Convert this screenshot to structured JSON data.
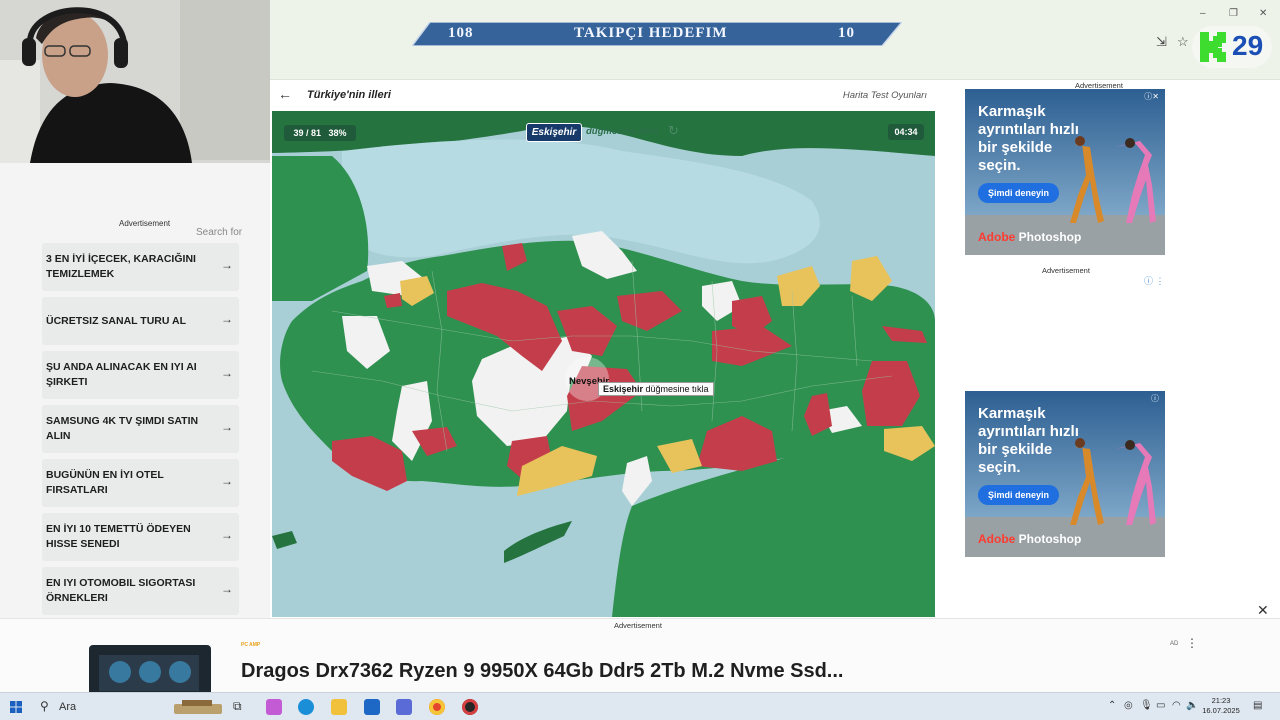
{
  "banner": {
    "left_number": "108",
    "title": "TAKIPÇI HEDEFIM",
    "right_number": "10"
  },
  "window_controls": {
    "minimize": "–",
    "maximize": "❐",
    "close": "✕"
  },
  "badge": {
    "letter": "K",
    "count": "29"
  },
  "left_sidebar": {
    "ad_label": "Advertisement",
    "search_for": "Search for",
    "links": [
      {
        "label": "3 EN İYİ İÇECEK, KARACIĞINI TEMIZLEMEK"
      },
      {
        "label": "ÜCRETSIZ SANAL TURU AL"
      },
      {
        "label": "ŞU ANDA ALINACAK EN IYI AI ŞIRKETI"
      },
      {
        "label": "SAMSUNG 4K TV ŞIMDI SATIN ALIN"
      },
      {
        "label": "BUGÜNÜN EN İYI OTEL FIRSATLARI"
      },
      {
        "label": "EN İYI 10 TEMETTÜ ÖDEYEN HISSE SENEDI"
      },
      {
        "label": "EN IYI OTOMOBIL SIGORTASI ÖRNEKLERI"
      }
    ],
    "arrow": "→"
  },
  "page_header": {
    "back": "←",
    "title": "Türkiye'nin illeri",
    "right_link": "Harita Test Oyunları"
  },
  "game": {
    "progress": "39 / 81",
    "percent": "38%",
    "target": "Eskişehir",
    "prompt": "düğmesine tıkla",
    "refresh": "↻",
    "timer": "04:34",
    "hover_label": "Nevşehir",
    "tooltip_bold": "Eskişehir",
    "tooltip_rest": " düğmesine tıkla"
  },
  "right_ads": {
    "top_label": "Advertisement",
    "mid_label": "Advertisement",
    "headline_lines": [
      "Karmaşık",
      "ayrıntıları hızlı",
      "bir şekilde",
      "seçin."
    ],
    "cta": "Şimdi deneyin",
    "brand_prefix": "Adobe",
    "brand_product": " Photoshop"
  },
  "bottom_ad": {
    "label": "Advertisement",
    "brand": "PC AMP",
    "title": "Dragos Drx7362 Ryzen 9 9950X 64Gb Ddr5 2Tb M.2 Nvme Ssd...",
    "ad_tag": "AD",
    "more": "⋮",
    "close": "✕"
  },
  "taskbar": {
    "search_placeholder": "Ara",
    "time": "21:23",
    "date": "16.07.2025"
  },
  "colors": {
    "correct": "#2f9150",
    "wrong": "#c43d4b",
    "partial": "#e8c25a",
    "unanswered": "#f2f2f2",
    "sea": "#a9cfd6"
  }
}
